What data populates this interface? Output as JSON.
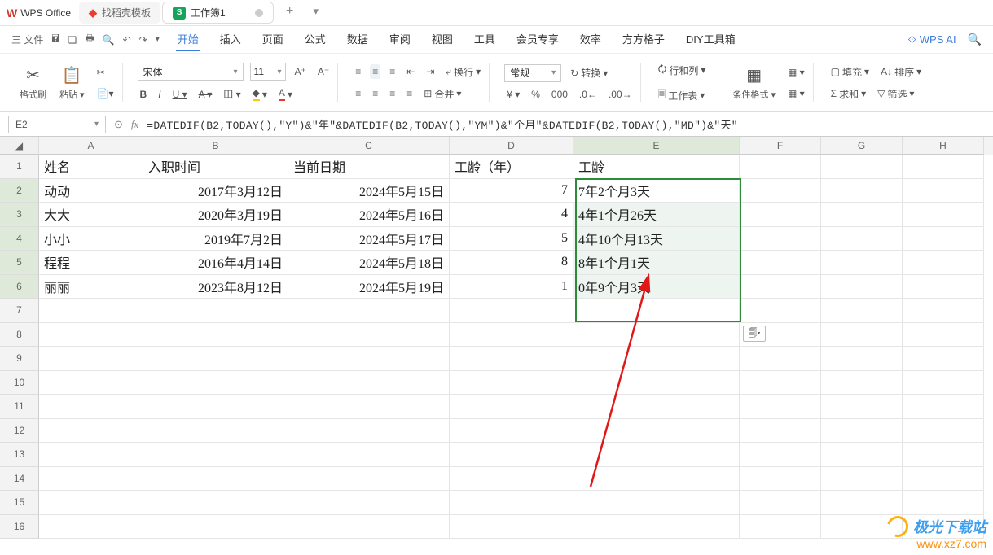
{
  "app": {
    "name": "WPS Office"
  },
  "tabs": [
    {
      "label": "找稻壳模板",
      "icon": "find",
      "active": false
    },
    {
      "label": "工作簿1",
      "icon": "sheet",
      "active": true
    }
  ],
  "qat": {
    "file_label": "三 文件"
  },
  "menu": {
    "items": [
      "开始",
      "插入",
      "页面",
      "公式",
      "数据",
      "审阅",
      "视图",
      "工具",
      "会员专享",
      "效率",
      "方方格子",
      "DIY工具箱"
    ],
    "active_index": 0,
    "ai_label": "WPS AI"
  },
  "ribbon": {
    "clipboard": {
      "format_painter": "格式刷",
      "paste": "粘贴"
    },
    "font": {
      "name": "宋体",
      "size": "11",
      "increase": "A⁺",
      "decrease": "A⁻",
      "bold": "B",
      "italic": "I",
      "underline": "U",
      "strike": "A"
    },
    "align": {
      "wrap": "换行",
      "merge": "合并"
    },
    "number": {
      "format": "常规",
      "convert": "转换"
    },
    "cells": {
      "rowcol": "行和列",
      "worksheet": "工作表"
    },
    "styles": {
      "cond_format": "条件格式"
    },
    "editing": {
      "fill": "填充",
      "sort": "排序",
      "sum": "求和",
      "filter": "筛选"
    }
  },
  "formula_bar": {
    "name_box": "E2",
    "formula": "=DATEDIF(B2,TODAY(),\"Y\")&\"年\"&DATEDIF(B2,TODAY(),\"YM\")&\"个月\"&DATEDIF(B2,TODAY(),\"MD\")&\"天\""
  },
  "sheet": {
    "columns": [
      "A",
      "B",
      "C",
      "D",
      "E",
      "F",
      "G",
      "H"
    ],
    "selected_col_index": 4,
    "headers": {
      "A": "姓名",
      "B": "入职时间",
      "C": "当前日期",
      "D": "工龄（年）",
      "E": "工龄"
    },
    "rows": [
      {
        "n": "2",
        "A": "动动",
        "B": "2017年3月12日",
        "C": "2024年5月15日",
        "D": "7",
        "E": "7年2个月3天"
      },
      {
        "n": "3",
        "A": "大大",
        "B": "2020年3月19日",
        "C": "2024年5月16日",
        "D": "4",
        "E": "4年1个月26天"
      },
      {
        "n": "4",
        "A": "小小",
        "B": "2019年7月2日",
        "C": "2024年5月17日",
        "D": "5",
        "E": "4年10个月13天"
      },
      {
        "n": "5",
        "A": "程程",
        "B": "2016年4月14日",
        "C": "2024年5月18日",
        "D": "8",
        "E": "8年1个月1天"
      },
      {
        "n": "6",
        "A": "丽丽",
        "B": "2023年8月12日",
        "C": "2024年5月19日",
        "D": "1",
        "E": "0年9个月3天"
      }
    ],
    "empty_rows": [
      "7",
      "8",
      "9",
      "10",
      "11",
      "12",
      "13",
      "14",
      "15",
      "16"
    ]
  },
  "watermark": {
    "title": "极光下载站",
    "url": "www.xz7.com"
  }
}
